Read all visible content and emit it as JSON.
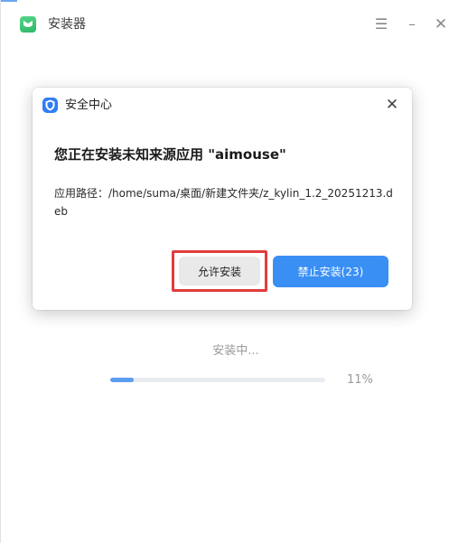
{
  "window": {
    "title": "安装器",
    "icon": "installer-app-icon",
    "menu_icon": "☰",
    "minimize_icon": "–",
    "close_icon": "✕"
  },
  "install_status": {
    "text": "安装中...",
    "progress_percent": 11,
    "progress_label": "11%"
  },
  "dialog": {
    "title": "安全中心",
    "icon": "security-shield-icon",
    "close_icon": "✕",
    "heading": "您正在安装未知来源应用 \"aimouse\"",
    "path_text": "应用路径：/home/suma/桌面/新建文件夹/z_kylin_1.2_20251213.deb",
    "allow_button": "允许安装",
    "forbid_button": "禁止安装(23)"
  },
  "colors": {
    "accent": "#3a8ff5",
    "highlight_border": "#e23c3c",
    "progress_fill": "#5b9ef0"
  }
}
